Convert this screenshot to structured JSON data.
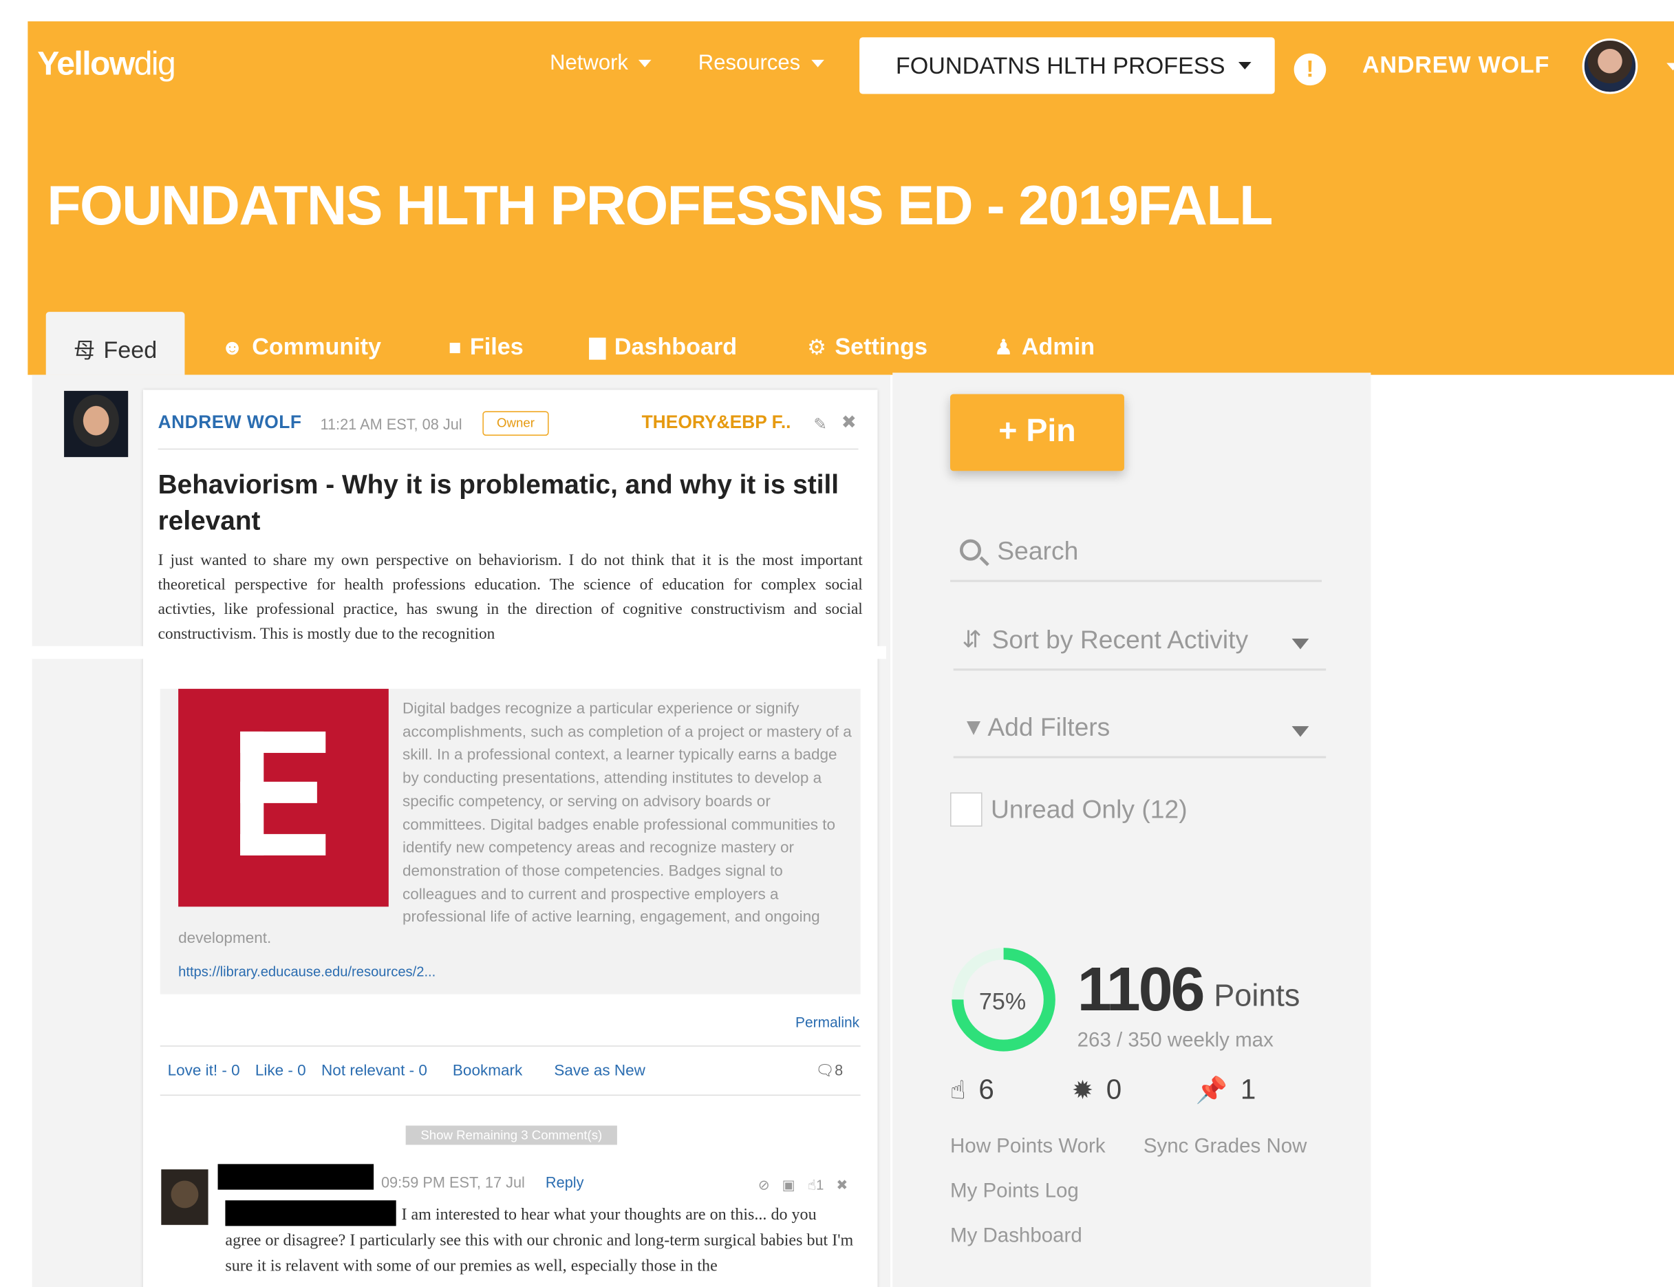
{
  "header": {
    "logo_bold": "Yellow",
    "logo_thin": "dig",
    "nav_network": "Network",
    "nav_resources": "Resources",
    "course_selector": "FOUNDATNS HLTH PROFESS",
    "alert_icon_glyph": "!",
    "user_name": "ANDREW WOLF",
    "course_title": "FOUNDATNS HLTH PROFESSNS ED - 2019FALL"
  },
  "tabs": [
    {
      "label": "Feed",
      "icon": "rss-icon",
      "active": true
    },
    {
      "label": "Community",
      "icon": "users-icon"
    },
    {
      "label": "Files",
      "icon": "file-icon"
    },
    {
      "label": "Dashboard",
      "icon": "bar-chart-icon"
    },
    {
      "label": "Settings",
      "icon": "gear-icon"
    },
    {
      "label": "Admin",
      "icon": "user-icon"
    }
  ],
  "post": {
    "author": "ANDREW WOLF",
    "time": "11:21 AM EST, 08 Jul",
    "badge": "Owner",
    "topic": "THEORY&EBP F..",
    "title": "Behaviorism - Why it is problematic, and why it is still relevant",
    "body": "I just wanted to share my own perspective on behaviorism. I do not think that it is the most important theoretical perspective for health professions education. The science of education for complex social activties, like professional practice, has swung in the direction of cognitive constructivism and social constructivism. This is mostly due to the recognition",
    "link_preview": {
      "letter": "E",
      "description": "Digital badges recognize a particular experience or signify accomplishments, such as completion of a project or mastery of a skill. In a professional context, a learner typically earns a badge by conducting presentations, attending institutes to develop a specific competency, or serving on advisory boards or committees. Digital badges enable professional communities to identify new competency areas and recognize mastery or demonstration of those competencies. Badges signal to colleagues and to current and prospective employers a professional life of active learning, engagement, and ongoing",
      "description_tail": "development.",
      "url": "https://library.educause.edu/resources/2..."
    },
    "permalink": "Permalink",
    "actions": {
      "love": "Love it! - 0",
      "like": "Like - 0",
      "not_relevant": "Not relevant - 0",
      "bookmark": "Bookmark",
      "save_new": "Save as New",
      "comments": "8"
    },
    "show_remaining": "Show Remaining 3 Comment(s)"
  },
  "comment": {
    "time": "09:59 PM EST, 17 Jul",
    "reply": "Reply",
    "likes": "1",
    "body": "I am interested to hear what your thoughts are on this... do you agree or disagree? I particularly see this with our chronic and long-term surgical babies but I'm sure it is relavent with some of our premies as well, especially those in the"
  },
  "sidebar": {
    "pin_label": "+ Pin",
    "search_placeholder": "Search",
    "sort_label": "Sort by Recent Activity",
    "filter_label": "Add Filters",
    "unread_label": "Unread Only (12)",
    "progress_percent": "75%",
    "progress_fraction": 0.75,
    "points": "1106",
    "points_word": "Points",
    "weekly": "263 / 350 weekly max",
    "likes_count": "6",
    "badges_count": "0",
    "pins_count": "1",
    "link_how_points": "How Points Work",
    "link_sync_grades": "Sync Grades Now",
    "link_points_log": "My Points Log",
    "link_dashboard": "My Dashboard"
  },
  "colors": {
    "brand": "#FBB131",
    "link": "#2a6cb0",
    "progress": "#2ee07a",
    "badge_red": "#c0152f"
  }
}
